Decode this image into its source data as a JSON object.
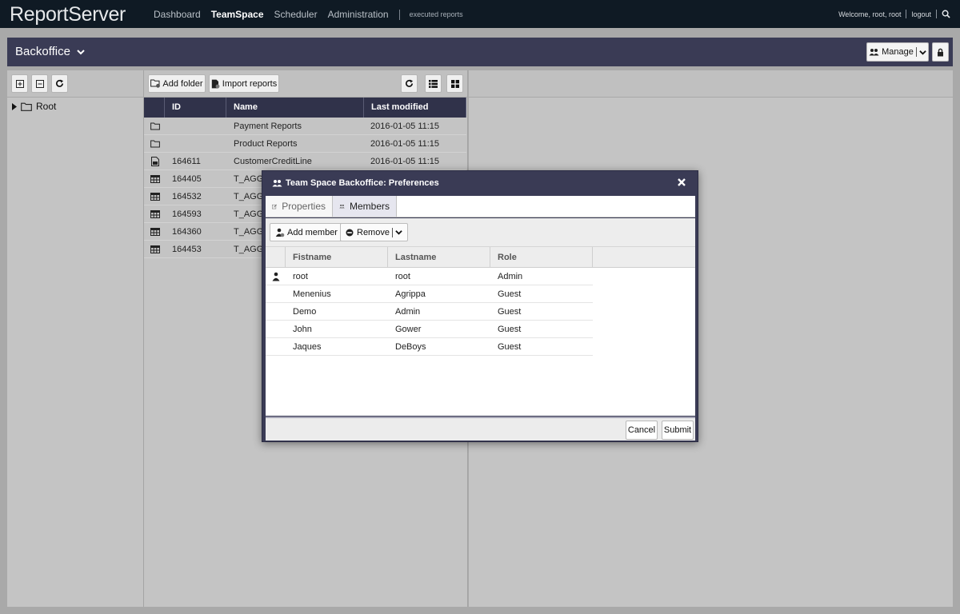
{
  "topbar": {
    "logo_part1": "Report",
    "logo_part2": "Server",
    "nav": [
      "Dashboard",
      "TeamSpace",
      "Scheduler",
      "Administration"
    ],
    "nav_extra": "executed reports",
    "welcome": "Welcome, root, root",
    "logout": "logout",
    "search_icon": "search-icon"
  },
  "header": {
    "title": "Backoffice",
    "manage_label": "Manage",
    "lock_icon": "lock-icon"
  },
  "tree": {
    "root_label": "Root"
  },
  "list_toolbar": {
    "add_folder": "Add folder",
    "import_reports": "Import reports"
  },
  "list": {
    "columns": [
      "ID",
      "Name",
      "Last modified"
    ],
    "rows": [
      {
        "icon": "folder-icon",
        "id": "",
        "name": "Payment Reports",
        "modified": "2016-01-05 11:15"
      },
      {
        "icon": "folder-icon",
        "id": "",
        "name": "Product Reports",
        "modified": "2016-01-05 11:15"
      },
      {
        "icon": "report-icon",
        "id": "164611",
        "name": "CustomerCreditLine",
        "modified": "2016-01-05 11:15"
      },
      {
        "icon": "table-icon",
        "id": "164405",
        "name": "T_AGG",
        "modified": ""
      },
      {
        "icon": "table-icon",
        "id": "164532",
        "name": "T_AGG",
        "modified": ""
      },
      {
        "icon": "table-icon",
        "id": "164593",
        "name": "T_AGG",
        "modified": ""
      },
      {
        "icon": "table-icon",
        "id": "164360",
        "name": "T_AGG",
        "modified": ""
      },
      {
        "icon": "table-icon",
        "id": "164453",
        "name": "T_AGG",
        "modified": ""
      }
    ]
  },
  "dialog": {
    "title": "Team Space Backoffice: Preferences",
    "tabs": [
      "Properties",
      "Members"
    ],
    "add_member": "Add member",
    "remove": "Remove",
    "columns": [
      "Fistname",
      "Lastname",
      "Role"
    ],
    "members": [
      {
        "first": "root",
        "last": "root",
        "role": "Admin",
        "owner": true
      },
      {
        "first": "Menenius",
        "last": "Agrippa",
        "role": "Guest",
        "owner": false
      },
      {
        "first": "Demo",
        "last": "Admin",
        "role": "Guest",
        "owner": false
      },
      {
        "first": "John",
        "last": "Gower",
        "role": "Guest",
        "owner": false
      },
      {
        "first": "Jaques",
        "last": "DeBoys",
        "role": "Guest",
        "owner": false
      }
    ],
    "cancel": "Cancel",
    "submit": "Submit"
  }
}
